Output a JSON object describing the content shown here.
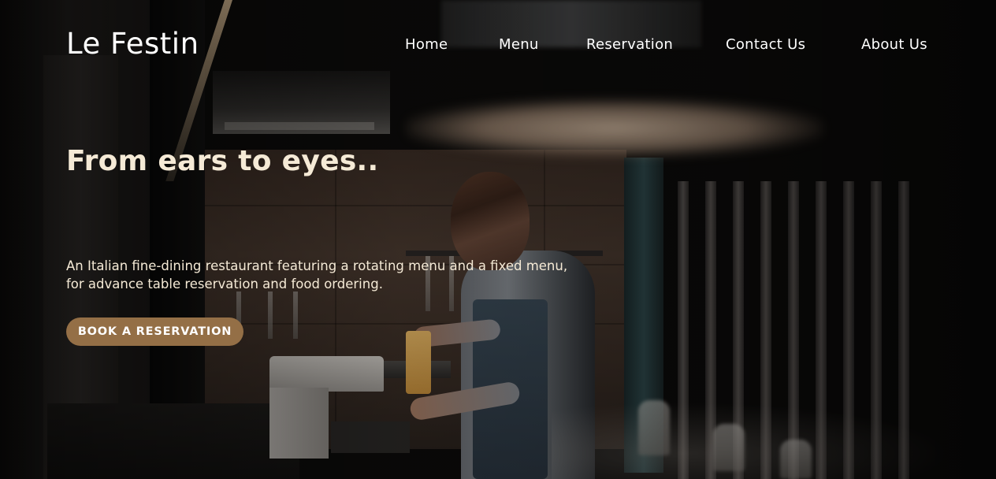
{
  "brand": {
    "name": "Le Festin"
  },
  "nav": {
    "items": [
      {
        "label": "Home"
      },
      {
        "label": "Menu"
      },
      {
        "label": "Reservation"
      },
      {
        "label": "Contact Us"
      },
      {
        "label": "About Us"
      }
    ]
  },
  "hero": {
    "title": "From ears to eyes..",
    "description": "An Italian fine-dining restaurant featuring a rotating menu and a fixed menu, for advance table reservation and food ordering.",
    "cta_label": "BOOK A RESERVATION",
    "background_image": "chef-in-kitchen-photo"
  },
  "colors": {
    "accent": "#946f46",
    "text_light": "#f5ead6",
    "nav_text": "#ffffff",
    "background": "#0c0b0a"
  }
}
